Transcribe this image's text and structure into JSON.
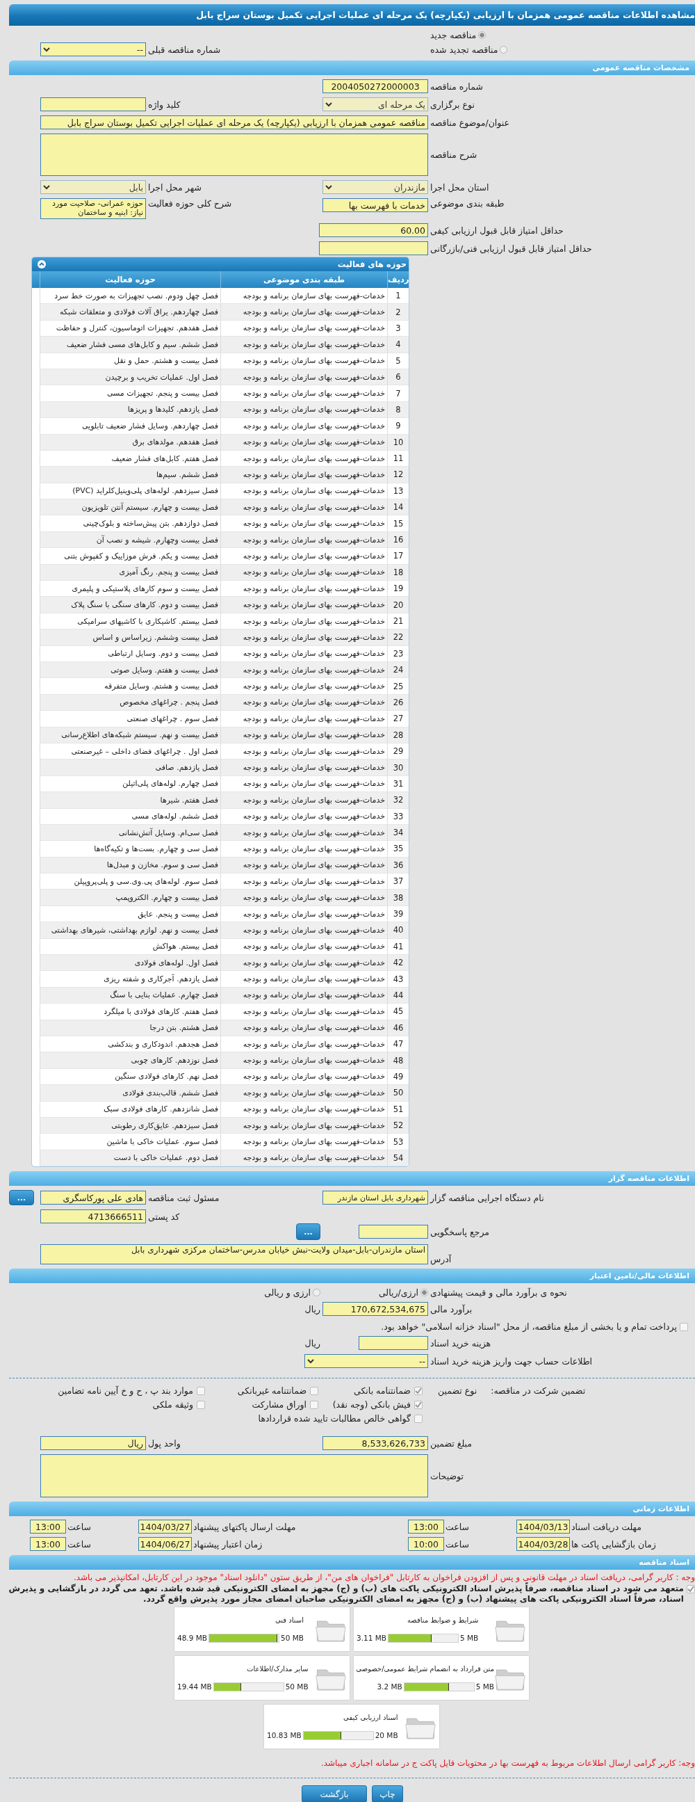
{
  "page_title": "مشاهده اطلاعات مناقصه عمومی همزمان با ارزیابی (یکپارچه) یک مرحله ای عملیات اجرایی تکمیل بوستان سراج بابل",
  "tender_kind": [
    {
      "label": "مناقصه جدید",
      "selected": true
    },
    {
      "label": "مناقصه تجدید شده",
      "selected": false
    }
  ],
  "previous_tender": {
    "label": "شماره مناقصه قبلی",
    "value": "--"
  },
  "general": {
    "title": "مشخصات مناقصه عمومی",
    "tender_number": {
      "label": "شماره مناقصه",
      "value": "2004050272000003"
    },
    "holding_type": {
      "label": "نوع برگزاری",
      "value": "یک مرحله ای"
    },
    "keyword": {
      "label": "کلید واژه"
    },
    "subject": {
      "label": "عنوان/موضوع مناقصه",
      "value": "مناقصه عمومی همزمان با ارزیابی (یکپارچه) یک مرحله ای عملیات اجرایی تکمیل بوستان سراج بابل"
    },
    "description": {
      "label": "شرح مناقصه"
    },
    "province": {
      "label": "استان محل اجرا",
      "value": "مازندران"
    },
    "city": {
      "label": "شهر محل اجرا",
      "value": "بابل"
    },
    "classification": {
      "label": "طبقه بندی موضوعی",
      "value": "خدمات با فهرست بها"
    },
    "activity_scope": {
      "label": "شرح کلی حوزه فعالیت",
      "value": "حوزه عمرانی- صلاحیت مورد نیاز: ابنیه و ساختمان"
    },
    "min_quality_score": {
      "label": "حداقل امتیاز قابل قبول ارزیابی کیفی",
      "value": "60.00"
    },
    "min_technical_score": {
      "label": "حداقل امتیاز قابل قبول ارزیابی فنی/بازرگانی"
    }
  },
  "activity_table": {
    "title": "حوزه های فعالیت",
    "columns": [
      "ردیف",
      "طبقه بندی موضوعی",
      "حوزه فعالیت"
    ],
    "rows": [
      [
        "1",
        "خدمات-فهرست بهای سازمان برنامه و بودجه",
        "فصل چهل ودوم. نصب تجهیزات به صورت خط سرد"
      ],
      [
        "2",
        "خدمات-فهرست بهای سازمان برنامه و بودجه",
        "فصل چهاردهم. یراق آلات فولادی و متعلقات شبکه"
      ],
      [
        "3",
        "خدمات-فهرست بهای سازمان برنامه و بودجه",
        "فصل هفدهم. تجهیزات اتوماسیون، کنترل و حفاظت"
      ],
      [
        "4",
        "خدمات-فهرست بهای سازمان برنامه و بودجه",
        "فصل ششم. سیم و کابل‌های مسی فشار ضعیف"
      ],
      [
        "5",
        "خدمات-فهرست بهای سازمان برنامه و بودجه",
        "فصل بیست و هشتم. حمل و نقل"
      ],
      [
        "6",
        "خدمات-فهرست بهای سازمان برنامه و بودجه",
        "فصل اول. عملیات تخریب و برچیدن"
      ],
      [
        "7",
        "خدمات-فهرست بهای سازمان برنامه و بودجه",
        "فصل بیست و پنجم. تجهیزات مسی"
      ],
      [
        "8",
        "خدمات-فهرست بهای سازمان برنامه و بودجه",
        "فصل یازدهم. کلیدها و پریزها"
      ],
      [
        "9",
        "خدمات-فهرست بهای سازمان برنامه و بودجه",
        "فصل چهاردهم. وسایل فشار ضعیف تابلویی"
      ],
      [
        "10",
        "خدمات-فهرست بهای سازمان برنامه و بودجه",
        "فصل هفدهم. مولدهای برق"
      ],
      [
        "11",
        "خدمات-فهرست بهای سازمان برنامه و بودجه",
        "فصل هفتم. کابل‌های فشار ضعیف"
      ],
      [
        "12",
        "خدمات-فهرست بهای سازمان برنامه و بودجه",
        "فصل ششم. سیم‌ها"
      ],
      [
        "13",
        "خدمات-فهرست بهای سازمان برنامه و بودجه",
        "فصل سیزدهم. لوله‌های پلی‌وینیل‌کلراید (PVC)"
      ],
      [
        "14",
        "خدمات-فهرست بهای سازمان برنامه و بودجه",
        "فصل بیست و چهارم. سیستم آنتن تلویزیون"
      ],
      [
        "15",
        "خدمات-فهرست بهای سازمان برنامه و بودجه",
        "فصل دوازدهم. بتن پیش‌ساخته و بلوک‌چینی"
      ],
      [
        "16",
        "خدمات-فهرست بهای سازمان برنامه و بودجه",
        "فصل بیست وچهارم. شیشه و نصب آن"
      ],
      [
        "17",
        "خدمات-فهرست بهای سازمان برنامه و بودجه",
        "فصل بیست و یکم. فرش موزاییک و کفپوش بتنی"
      ],
      [
        "18",
        "خدمات-فهرست بهای سازمان برنامه و بودجه",
        "فصل بیست و پنجم. رنگ آمیزی"
      ],
      [
        "19",
        "خدمات-فهرست بهای سازمان برنامه و بودجه",
        "فصل بیست و سوم کارهای پلاستیکی و پلیمری"
      ],
      [
        "20",
        "خدمات-فهرست بهای سازمان برنامه و بودجه",
        "فصل بیست و دوم. کارهای سنگی با سنگ پلاک"
      ],
      [
        "21",
        "خدمات-فهرست بهای سازمان برنامه و بودجه",
        "فصل بیستم. کاشیکاری با کاشیهای سرامیکی"
      ],
      [
        "22",
        "خدمات-فهرست بهای سازمان برنامه و بودجه",
        "فصل بیست وششم. زیراساس و اساس"
      ],
      [
        "23",
        "خدمات-فهرست بهای سازمان برنامه و بودجه",
        "فصل بیست و دوم. وسایل ارتباطی"
      ],
      [
        "24",
        "خدمات-فهرست بهای سازمان برنامه و بودجه",
        "فصل بیست و هفتم. وسایل صوتی"
      ],
      [
        "25",
        "خدمات-فهرست بهای سازمان برنامه و بودجه",
        "فصل بیست و هشتم. وسایل متفرقه"
      ],
      [
        "26",
        "خدمات-فهرست بهای سازمان برنامه و بودجه",
        "فصل پنجم . چراغهای مخصوص"
      ],
      [
        "27",
        "خدمات-فهرست بهای سازمان برنامه و بودجه",
        "فصل سوم . چراغهای صنعتی"
      ],
      [
        "28",
        "خدمات-فهرست بهای سازمان برنامه و بودجه",
        "فصل بیست و نهم. سیستم شبکه‌های اطلاع‌رسانی"
      ],
      [
        "29",
        "خدمات-فهرست بهای سازمان برنامه و بودجه",
        "فصل اول . چراغهای فضای داخلی – غیرصنعتی"
      ],
      [
        "30",
        "خدمات-فهرست بهای سازمان برنامه و بودجه",
        "فصل یازدهم. صافی"
      ],
      [
        "31",
        "خدمات-فهرست بهای سازمان برنامه و بودجه",
        "فصل چهارم. لوله‌های پلی‌اتیلن"
      ],
      [
        "32",
        "خدمات-فهرست بهای سازمان برنامه و بودجه",
        "فصل هفتم. شیرها"
      ],
      [
        "33",
        "خدمات-فهرست بهای سازمان برنامه و بودجه",
        "فصل ششم. لوله‌های مسی"
      ],
      [
        "34",
        "خدمات-فهرست بهای سازمان برنامه و بودجه",
        "فصل سی‌ام. وسایل آتش‌نشانی"
      ],
      [
        "35",
        "خدمات-فهرست بهای سازمان برنامه و بودجه",
        "فصل سی و چهارم. بست‌ها و تکیه‌گاه‌ها"
      ],
      [
        "36",
        "خدمات-فهرست بهای سازمان برنامه و بودجه",
        "فصل سی و سوم. مخازن و مبدل‌ها"
      ],
      [
        "37",
        "خدمات-فهرست بهای سازمان برنامه و بودجه",
        "فصل سوم. لوله‌های پی.وی.سی و پلی‌پروپیلن"
      ],
      [
        "38",
        "خدمات-فهرست بهای سازمان برنامه و بودجه",
        "فصل بیست و چهارم. الکتروپمپ"
      ],
      [
        "39",
        "خدمات-فهرست بهای سازمان برنامه و بودجه",
        "فصل بیست و پنجم. عایق"
      ],
      [
        "40",
        "خدمات-فهرست بهای سازمان برنامه و بودجه",
        "فصل بیست و نهم. لوازم بهداشتی، شیرهای بهداشتی"
      ],
      [
        "41",
        "خدمات-فهرست بهای سازمان برنامه و بودجه",
        "فصل بیستم. هواکش"
      ],
      [
        "42",
        "خدمات-فهرست بهای سازمان برنامه و بودجه",
        "فصل اول. لوله‌های فولادی"
      ],
      [
        "43",
        "خدمات-فهرست بهای سازمان برنامه و بودجه",
        "فصل یازدهم. آجرکاری و شفته ریزی"
      ],
      [
        "44",
        "خدمات-فهرست بهای سازمان برنامه و بودجه",
        "فصل چهارم. عملیات بنایی با سنگ"
      ],
      [
        "45",
        "خدمات-فهرست بهای سازمان برنامه و بودجه",
        "فصل هفتم. کارهای فولادی با میلگرد"
      ],
      [
        "46",
        "خدمات-فهرست بهای سازمان برنامه و بودجه",
        "فصل هشتم. بتن درجا"
      ],
      [
        "47",
        "خدمات-فهرست بهای سازمان برنامه و بودجه",
        "فصل هجدهم. اندودکاری و بندکشی"
      ],
      [
        "48",
        "خدمات-فهرست بهای سازمان برنامه و بودجه",
        "فصل نوزدهم. کارهای چوبی"
      ],
      [
        "49",
        "خدمات-فهرست بهای سازمان برنامه و بودجه",
        "فصل نهم. کارهای فولادی سنگین"
      ],
      [
        "50",
        "خدمات-فهرست بهای سازمان برنامه و بودجه",
        "فصل ششم. قالب‌بندی فولادی"
      ],
      [
        "51",
        "خدمات-فهرست بهای سازمان برنامه و بودجه",
        "فصل شانزدهم. کارهای فولادی سبک"
      ],
      [
        "52",
        "خدمات-فهرست بهای سازمان برنامه و بودجه",
        "فصل سیزدهم. عایق‌کاری رطوبتی"
      ],
      [
        "53",
        "خدمات-فهرست بهای سازمان برنامه و بودجه",
        "فصل سوم. عملیات خاکی با ماشین"
      ],
      [
        "54",
        "خدمات-فهرست بهای سازمان برنامه و بودجه",
        "فصل دوم. عملیات خاکی با دست"
      ]
    ]
  },
  "organizer": {
    "title": "اطلاعات مناقصه گزار",
    "agency": {
      "label": "نام دستگاه اجرایی مناقصه گزار",
      "value": "شهرداری بابل استان مازندر"
    },
    "registrar": {
      "label": "مسئول ثبت مناقصه",
      "value": "هادی علی پورکاسگری",
      "button": "..."
    },
    "contact_ref": {
      "label": "مرجع پاسخگویی",
      "button": "..."
    },
    "postal_code": {
      "label": "کد پستی",
      "value": "4713666511"
    },
    "address": {
      "label": "آدرس",
      "value": "استان مازندران-بابل-میدان ولایت-نبش خیابان مدرس-ساختمان مرکزی شهرداری بابل"
    }
  },
  "financial": {
    "title": "اطلاعات مالی/تامین اعتبار",
    "estimate_method": {
      "label": "نحوه ی برآورد مالی و قیمت پیشنهادی",
      "options": [
        {
          "label": "ارزی/ریالی",
          "selected": true
        },
        {
          "label": "ارزی و ریالی",
          "selected": false
        }
      ]
    },
    "estimate": {
      "label": "برآورد مالی",
      "value": "170,672,534,675",
      "unit": "ریال"
    },
    "treasury": {
      "label": "پرداخت تمام و یا بخشی از مبلغ مناقصه، از محل \"اسناد خزانه اسلامی\" خواهد بود.",
      "checked": false
    },
    "doc_fee": {
      "label": "هزینه خرید اسناد",
      "unit": "ریال"
    },
    "fee_account": {
      "label": "اطلاعات حساب جهت واریز هزینه خرید اسناد",
      "value": "--"
    }
  },
  "guarantee": {
    "label": "تضمین شرکت در مناقصه:",
    "type_label": "نوع تضمین",
    "options": [
      {
        "label": "ضمانتنامه بانکی",
        "checked": true
      },
      {
        "label": "ضمانتنامه غیربانکی",
        "checked": false
      },
      {
        "label": "موارد بند پ ، ح و خ آیین نامه تضامین",
        "checked": false
      },
      {
        "label": "فیش بانکی (وجه نقد)",
        "checked": true
      },
      {
        "label": "اوراق مشارکت",
        "checked": false
      },
      {
        "label": "وثیقه ملکی",
        "checked": false
      },
      {
        "label": "گواهی خالص مطالبات تایید شده قراردادها",
        "checked": false
      }
    ],
    "amount": {
      "label": "مبلغ تضمین",
      "value": "8,533,626,733"
    },
    "currency": {
      "label": "واحد پول",
      "value": "ریال"
    },
    "notes": {
      "label": "توضیحات"
    }
  },
  "timing": {
    "title": "اطلاعات زمانی",
    "items": [
      {
        "label": "مهلت دریافت اسناد",
        "date": "1404/03/13",
        "time_label": "ساعت",
        "time": "13:00"
      },
      {
        "label": "مهلت ارسال پاکتهای پیشنهاد",
        "date": "1404/03/27",
        "time_label": "ساعت",
        "time": "13:00"
      },
      {
        "label": "زمان بازگشایی پاکت ها",
        "date": "1404/03/28",
        "time_label": "ساعت",
        "time": "10:00"
      },
      {
        "label": "زمان اعتبار پیشنهاد",
        "date": "1404/06/27",
        "time_label": "ساعت",
        "time": "13:00"
      }
    ]
  },
  "documents": {
    "title": "اسناد مناقصه",
    "notice": "وجه : کاربر گرامی، دریافت اسناد در مهلت قانونی و پس از افزودن فراخوان به کارتابل \"فراخوان های من\"، از طریق ستون \"دانلود اسناد\" موجود در این کارتابل، امکانپذیر می باشد.",
    "commitment": {
      "text": "متعهد می شود در اسناد مناقصه، صرفاً پذیرش اسناد الکترونیکی پاکت های (ب) و (ج) مجهز به امضای الکترونیکی قید شده باشد. تعهد می گردد در بازگشایی و پذیرش اسناد، صرفاً اسناد الکترونیکی پاکت های پیشنهاد (ب) و (ج) مجهز به امضای الکترونیکی صاحبان امضای مجاز مورد پذیرش واقع گردد.",
      "checked": true
    },
    "files": [
      {
        "name": "شرایط و ضوابط مناقصه",
        "used": "3.11 MB",
        "max": "5 MB",
        "level": 0.622
      },
      {
        "name": "اسناد فنی",
        "used": "48.9 MB",
        "max": "50 MB",
        "level": 0.978
      },
      {
        "name": "متن قرارداد به انضمام شرایط عمومی/خصوصی",
        "used": "3.2 MB",
        "max": "5 MB",
        "level": 0.64
      },
      {
        "name": "سایر مدارک/اطلاعات",
        "used": "19.44 MB",
        "max": "50 MB",
        "level": 0.389
      },
      {
        "name": "اسناد ارزیابی کیفی",
        "used": "10.83 MB",
        "max": "20 MB",
        "level": 0.54
      }
    ],
    "footer_note": "وجه: کاربر گرامی ارسال اطلاعات مربوط به فهرست بها در محتویات فایل پاکت ج در سامانه اجباری میباشد."
  },
  "buttons": [
    {
      "label": "چاپ"
    },
    {
      "label": "بازگشت"
    }
  ]
}
